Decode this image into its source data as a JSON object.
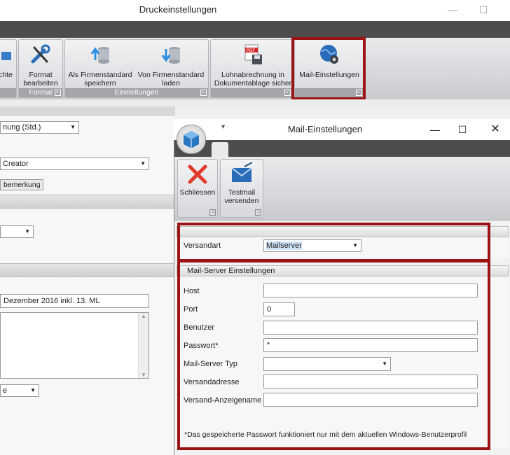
{
  "window": {
    "title": "Druckeinstellungen"
  },
  "ribbon": {
    "cut_button_label": "chte",
    "format_button_label": [
      "Format",
      "bearbeiten"
    ],
    "format_group": "Format",
    "als_firmenstandard": [
      "Als Firmenstandard",
      "speichern"
    ],
    "von_firmenstandard": [
      "Von Firmenstandard",
      "laden"
    ],
    "einstellungen_group": "Einstellungen",
    "lohnabrechnung": [
      "Lohnabrechnung in",
      "Dokumentablage sicher"
    ],
    "mail_einstellungen": "Mail-Einstellungen"
  },
  "left": {
    "combo1": "nung (Std.)",
    "combo2": "Creator",
    "tab": "bemerkung",
    "field_text": "Dezember 2016 inkl. 13. ML",
    "combo4": "e"
  },
  "dialog": {
    "title": "Mail-Einstellungen",
    "close_button": "Schliessen",
    "testmail_button": [
      "Testmail",
      "versenden"
    ],
    "versandart_label": "Versandart",
    "versandart_value": "Mailserver",
    "section_title": "Mail-Server Einstellungen",
    "fields": {
      "host_label": "Host",
      "host_value": "",
      "port_label": "Port",
      "port_value": "0",
      "benutzer_label": "Benutzer",
      "benutzer_value": "",
      "passwort_label": "Passwort*",
      "passwort_value": "*",
      "typ_label": "Mail-Server Typ",
      "typ_value": "",
      "adresse_label": "Versandadresse",
      "adresse_value": "",
      "anzeigename_label": "Versand-Anzeigename",
      "anzeigename_value": ""
    },
    "footnote": "*Das gespeicherte Passwort funktioniert nur  mit dem aktuellen Windows-Benutzerprofil"
  },
  "colors": {
    "highlight": "#9b1414",
    "dark_strip": "#4d4d4d",
    "group_label_bg": "#a3a5a9"
  }
}
